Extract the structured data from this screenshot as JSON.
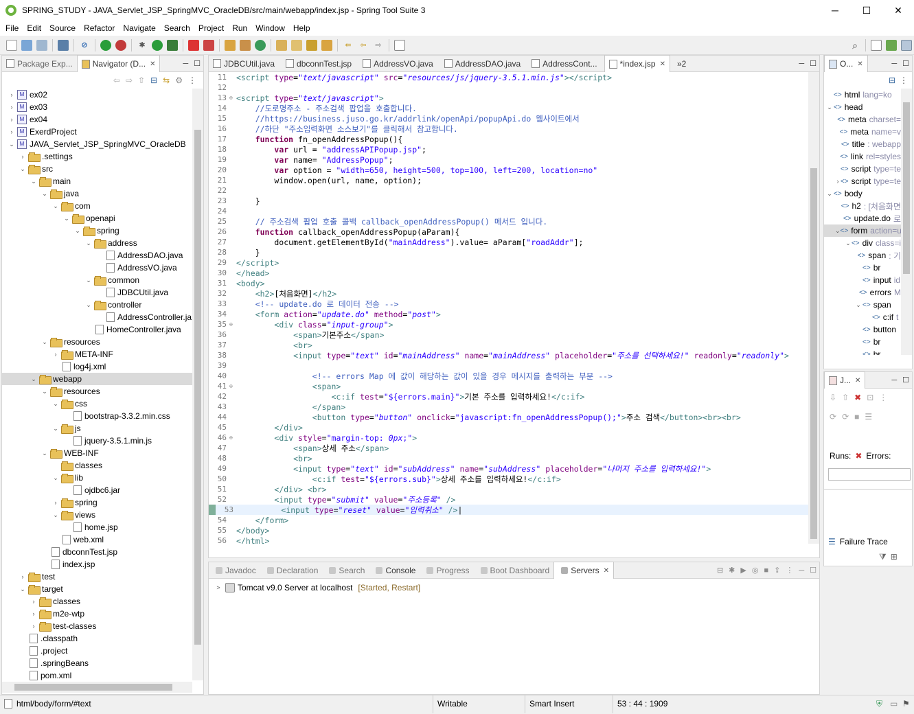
{
  "window": {
    "title": "SPRING_STUDY - JAVA_Servlet_JSP_SpringMVC_OracleDB/src/main/webapp/index.jsp - Spring Tool Suite 3",
    "minimize": "─",
    "maximize": "☐",
    "close": "✕"
  },
  "menu": [
    "File",
    "Edit",
    "Source",
    "Refactor",
    "Navigate",
    "Search",
    "Project",
    "Run",
    "Window",
    "Help"
  ],
  "left_panel": {
    "tabs": [
      {
        "label": "Package Exp..."
      },
      {
        "label": "Navigator (D...",
        "active": true
      }
    ]
  },
  "tree": [
    {
      "indent": 0,
      "twisty": ">",
      "type": "proj",
      "label": "ex02"
    },
    {
      "indent": 0,
      "twisty": ">",
      "type": "proj",
      "label": "ex03"
    },
    {
      "indent": 0,
      "twisty": ">",
      "type": "proj",
      "label": "ex04"
    },
    {
      "indent": 0,
      "twisty": ">",
      "type": "proj",
      "label": "ExerdProject"
    },
    {
      "indent": 0,
      "twisty": "v",
      "type": "proj",
      "label": "JAVA_Servlet_JSP_SpringMVC_OracleDB"
    },
    {
      "indent": 1,
      "twisty": ">",
      "type": "folder",
      "label": ".settings"
    },
    {
      "indent": 1,
      "twisty": "v",
      "type": "folder",
      "label": "src"
    },
    {
      "indent": 2,
      "twisty": "v",
      "type": "folder",
      "label": "main"
    },
    {
      "indent": 3,
      "twisty": "v",
      "type": "folder",
      "label": "java"
    },
    {
      "indent": 4,
      "twisty": "v",
      "type": "folder",
      "label": "com"
    },
    {
      "indent": 5,
      "twisty": "v",
      "type": "folder",
      "label": "openapi"
    },
    {
      "indent": 6,
      "twisty": "v",
      "type": "folder",
      "label": "spring"
    },
    {
      "indent": 7,
      "twisty": "v",
      "type": "folder",
      "label": "address"
    },
    {
      "indent": 8,
      "twisty": "",
      "type": "file",
      "label": "AddressDAO.java"
    },
    {
      "indent": 8,
      "twisty": "",
      "type": "file",
      "label": "AddressVO.java"
    },
    {
      "indent": 7,
      "twisty": "v",
      "type": "folder",
      "label": "common"
    },
    {
      "indent": 8,
      "twisty": "",
      "type": "file",
      "label": "JDBCUtil.java"
    },
    {
      "indent": 7,
      "twisty": "v",
      "type": "folder",
      "label": "controller"
    },
    {
      "indent": 8,
      "twisty": "",
      "type": "file",
      "label": "AddressController.ja"
    },
    {
      "indent": 7,
      "twisty": "",
      "type": "file",
      "label": "HomeController.java"
    },
    {
      "indent": 3,
      "twisty": "v",
      "type": "folder",
      "label": "resources"
    },
    {
      "indent": 4,
      "twisty": ">",
      "type": "folder",
      "label": "META-INF"
    },
    {
      "indent": 4,
      "twisty": "",
      "type": "file",
      "label": "log4j.xml"
    },
    {
      "indent": 2,
      "twisty": "v",
      "type": "folder",
      "label": "webapp",
      "selected": true
    },
    {
      "indent": 3,
      "twisty": "v",
      "type": "folder",
      "label": "resources"
    },
    {
      "indent": 4,
      "twisty": "v",
      "type": "folder",
      "label": "css"
    },
    {
      "indent": 5,
      "twisty": "",
      "type": "file",
      "label": "bootstrap-3.3.2.min.css"
    },
    {
      "indent": 4,
      "twisty": "v",
      "type": "folder",
      "label": "js"
    },
    {
      "indent": 5,
      "twisty": "",
      "type": "file",
      "label": "jquery-3.5.1.min.js"
    },
    {
      "indent": 3,
      "twisty": "v",
      "type": "folder",
      "label": "WEB-INF"
    },
    {
      "indent": 4,
      "twisty": "",
      "type": "folder",
      "label": "classes"
    },
    {
      "indent": 4,
      "twisty": "v",
      "type": "folder",
      "label": "lib"
    },
    {
      "indent": 5,
      "twisty": "",
      "type": "file",
      "label": "ojdbc6.jar"
    },
    {
      "indent": 4,
      "twisty": ">",
      "type": "folder",
      "label": "spring"
    },
    {
      "indent": 4,
      "twisty": "v",
      "type": "folder",
      "label": "views"
    },
    {
      "indent": 5,
      "twisty": "",
      "type": "file",
      "label": "home.jsp"
    },
    {
      "indent": 4,
      "twisty": "",
      "type": "file",
      "label": "web.xml"
    },
    {
      "indent": 3,
      "twisty": "",
      "type": "file",
      "label": "dbconnTest.jsp"
    },
    {
      "indent": 3,
      "twisty": "",
      "type": "file",
      "label": "index.jsp"
    },
    {
      "indent": 1,
      "twisty": ">",
      "type": "folder",
      "label": "test"
    },
    {
      "indent": 1,
      "twisty": "v",
      "type": "folder",
      "label": "target"
    },
    {
      "indent": 2,
      "twisty": ">",
      "type": "folder",
      "label": "classes"
    },
    {
      "indent": 2,
      "twisty": ">",
      "type": "folder",
      "label": "m2e-wtp"
    },
    {
      "indent": 2,
      "twisty": ">",
      "type": "folder",
      "label": "test-classes"
    },
    {
      "indent": 1,
      "twisty": "",
      "type": "file",
      "label": ".classpath"
    },
    {
      "indent": 1,
      "twisty": "",
      "type": "file",
      "label": ".project"
    },
    {
      "indent": 1,
      "twisty": "",
      "type": "file",
      "label": ".springBeans"
    },
    {
      "indent": 1,
      "twisty": "",
      "type": "file",
      "label": "pom.xml"
    }
  ],
  "editor": {
    "tabs": [
      {
        "label": "JDBCUtil.java"
      },
      {
        "label": "dbconnTest.jsp"
      },
      {
        "label": "AddressVO.java"
      },
      {
        "label": "AddressDAO.java"
      },
      {
        "label": "AddressCont..."
      },
      {
        "label": "*index.jsp",
        "active": true
      }
    ],
    "overflow": "»2"
  },
  "code": [
    {
      "n": "11",
      "f": "",
      "h": "<span class='tag'>&lt;script</span> <span class='attr'>type</span>=<span class='val'>\"text/javascript\"</span> <span class='attr'>src</span>=<span class='val'>\"resources/js/jquery-3.5.1.min.js\"</span><span class='tag'>&gt;&lt;/script&gt;</span>"
    },
    {
      "n": "12",
      "f": "",
      "h": ""
    },
    {
      "n": "13",
      "f": "⊖",
      "h": "<span class='tag'>&lt;script</span> <span class='attr'>type</span>=<span class='val'>\"text/javascript\"</span><span class='tag'>&gt;</span>"
    },
    {
      "n": "14",
      "f": "",
      "h": "    <span class='cmt'>//도로명주소 - 주소검색 팝업을 호출합니다.</span>"
    },
    {
      "n": "15",
      "f": "",
      "h": "    <span class='cmt'>//https://business.juso.go.kr/addrlink/openApi/popupApi.do 웹사이트에서</span>"
    },
    {
      "n": "16",
      "f": "",
      "h": "    <span class='cmt'>//하단 \"주소입력화면 소스보기\"를 클릭해서 참고합니다.</span>"
    },
    {
      "n": "17",
      "f": "",
      "h": "    <span class='kw'>function</span> fn_openAddressPopup(){"
    },
    {
      "n": "18",
      "f": "",
      "h": "        <span class='kw'>var</span> url = <span class='str'>\"addressAPIPopup.jsp\"</span>;"
    },
    {
      "n": "19",
      "f": "",
      "h": "        <span class='kw'>var</span> name= <span class='str'>\"AddressPopup\"</span>;"
    },
    {
      "n": "20",
      "f": "",
      "h": "        <span class='kw'>var</span> option = <span class='str'>\"width=650, height=500, top=100, left=200, location=no\"</span>"
    },
    {
      "n": "21",
      "f": "",
      "h": "        window.open(url, name, option);"
    },
    {
      "n": "22",
      "f": "",
      "h": ""
    },
    {
      "n": "23",
      "f": "",
      "h": "    }"
    },
    {
      "n": "24",
      "f": "",
      "h": ""
    },
    {
      "n": "25",
      "f": "",
      "h": "    <span class='cmt'>// 주소검색 팝업 호출 콜백 callback_openAddressPopup() 메서드 입니다.</span>"
    },
    {
      "n": "26",
      "f": "",
      "h": "    <span class='kw'>function</span> callback_openAddressPopup(aParam){"
    },
    {
      "n": "27",
      "f": "",
      "h": "        document.getElementById(<span class='str'>\"mainAddress\"</span>).value= aParam[<span class='str'>\"roadAddr\"</span>];"
    },
    {
      "n": "28",
      "f": "",
      "h": "    }"
    },
    {
      "n": "29",
      "f": "",
      "h": "<span class='tag'>&lt;/script&gt;</span>"
    },
    {
      "n": "30",
      "f": "",
      "h": "<span class='tag'>&lt;/head&gt;</span>"
    },
    {
      "n": "31",
      "f": "",
      "h": "<span class='tag'>&lt;body&gt;</span>"
    },
    {
      "n": "32",
      "f": "",
      "h": "    <span class='tag'>&lt;h2&gt;</span>[처음화면]<span class='tag'>&lt;/h2&gt;</span>"
    },
    {
      "n": "33",
      "f": "",
      "h": "    <span class='cmt'>&lt;!-- update.do 로 데이터 전송 --&gt;</span>"
    },
    {
      "n": "34",
      "f": "",
      "h": "    <span class='tag'>&lt;form</span> <span class='attr'>action</span>=<span class='val'>\"update.do\"</span> <span class='attr'>method</span>=<span class='val'>\"post\"</span><span class='tag'>&gt;</span>"
    },
    {
      "n": "35",
      "f": "⊖",
      "h": "        <span class='tag'>&lt;div</span> <span class='attr'>class</span>=<span class='val'>\"input-group\"</span><span class='tag'>&gt;</span>"
    },
    {
      "n": "36",
      "f": "",
      "h": "            <span class='tag'>&lt;span&gt;</span>기본주소<span class='tag'>&lt;/span&gt;</span>"
    },
    {
      "n": "37",
      "f": "",
      "h": "            <span class='tag'>&lt;br&gt;</span>"
    },
    {
      "n": "38",
      "f": "",
      "h": "            <span class='tag'>&lt;input</span> <span class='attr'>type</span>=<span class='val'>\"text\"</span> <span class='attr'>id</span>=<span class='val'>\"mainAddress\"</span> <span class='attr'>name</span>=<span class='val'>\"mainAddress\"</span> <span class='attr'>placeholder</span>=<span class='val'>\"주소를 선택하세요!\"</span> <span class='attr'>readonly</span>=<span class='val'>\"readonly\"</span><span class='tag'>&gt;</span>"
    },
    {
      "n": "39",
      "f": "",
      "h": ""
    },
    {
      "n": "40",
      "f": "",
      "h": "                <span class='cmt'>&lt;!-- errors Map 에 값이 해당하는 값이 있을 경우 메시지를 출력하는 부분 --&gt;</span>"
    },
    {
      "n": "41",
      "f": "⊖",
      "h": "                <span class='tag'>&lt;span&gt;</span>"
    },
    {
      "n": "42",
      "f": "",
      "h": "                    <span class='tag'>&lt;c:if</span> <span class='attr'>test</span>=<span class='str'>\"${errors.main}\"</span><span class='tag'>&gt;</span>기본 주소를 입력하세요!<span class='tag'>&lt;/c:if&gt;</span>"
    },
    {
      "n": "43",
      "f": "",
      "h": "                <span class='tag'>&lt;/span&gt;</span>"
    },
    {
      "n": "44",
      "f": "",
      "h": "                <span class='tag'>&lt;button</span> <span class='attr'>type</span>=<span class='val'>\"button\"</span> <span class='attr'>onclick</span>=<span class='str'>\"javascript:fn_openAddressPopup();\"</span><span class='tag'>&gt;</span>주소 검색<span class='tag'>&lt;/button&gt;&lt;br&gt;&lt;br&gt;</span>"
    },
    {
      "n": "45",
      "f": "",
      "h": "        <span class='tag'>&lt;/div&gt;</span>"
    },
    {
      "n": "46",
      "f": "⊖",
      "h": "        <span class='tag'>&lt;div</span> <span class='attr'>style</span>=<span class='str'>\"margin-top: <i>0px</i>;\"</span><span class='tag'>&gt;</span>"
    },
    {
      "n": "47",
      "f": "",
      "h": "            <span class='tag'>&lt;span&gt;</span>상세 주소<span class='tag'>&lt;/span&gt;</span>"
    },
    {
      "n": "48",
      "f": "",
      "h": "            <span class='tag'>&lt;br&gt;</span>"
    },
    {
      "n": "49",
      "f": "",
      "h": "            <span class='tag'>&lt;input</span> <span class='attr'>type</span>=<span class='val'>\"text\"</span> <span class='attr'>id</span>=<span class='val'>\"subAddress\"</span> <span class='attr'>name</span>=<span class='val'>\"subAddress\"</span> <span class='attr'>placeholder</span>=<span class='val'>\"나머지 주소를 입력하세요!\"</span><span class='tag'>&gt;</span>"
    },
    {
      "n": "50",
      "f": "",
      "h": "                <span class='tag'>&lt;c:if</span> <span class='attr'>test</span>=<span class='str'>\"${errors.sub}\"</span><span class='tag'>&gt;</span>상세 주소를 입력하세요!<span class='tag'>&lt;/c:if&gt;</span>"
    },
    {
      "n": "51",
      "f": "",
      "h": "        <span class='tag'>&lt;/div&gt;</span> <span class='tag'>&lt;br&gt;</span>"
    },
    {
      "n": "52",
      "f": "",
      "h": "        <span class='tag'>&lt;input</span> <span class='attr'>type</span>=<span class='val'>\"submit\"</span> <span class='attr'>value</span>=<span class='val'>\"주소등록\"</span> <span class='tag'>/&gt;</span>"
    },
    {
      "n": "53",
      "f": "",
      "h": "        <span class='tag'>&lt;input</span> <span class='attr'>type</span>=<span class='val'>\"reset\"</span> <span class='attr'>value</span>=<span class='val'>\"입력취소\"</span> <span class='tag'>/&gt;</span>|",
      "current": true
    },
    {
      "n": "54",
      "f": "",
      "h": "    <span class='tag'>&lt;/form&gt;</span>"
    },
    {
      "n": "55",
      "f": "",
      "h": "<span class='tag'>&lt;/body&gt;</span>"
    },
    {
      "n": "56",
      "f": "",
      "h": "<span class='tag'>&lt;/html&gt;</span>"
    }
  ],
  "outline": {
    "tab": "O...",
    "items": [
      {
        "indent": 0,
        "label": "html",
        "extra": "lang=ko"
      },
      {
        "indent": 0,
        "label": "head",
        "tw": "v"
      },
      {
        "indent": 1,
        "label": "meta",
        "extra": "charset="
      },
      {
        "indent": 1,
        "label": "meta",
        "extra": "name=v"
      },
      {
        "indent": 1,
        "label": "title",
        "extra": ": webapp"
      },
      {
        "indent": 1,
        "label": "link",
        "extra": "rel=styles"
      },
      {
        "indent": 1,
        "label": "script",
        "extra": "type=te"
      },
      {
        "indent": 1,
        "label": "script",
        "extra": "type=te",
        "tw": ">"
      },
      {
        "indent": 0,
        "label": "body",
        "tw": "v"
      },
      {
        "indent": 1,
        "label": "h2",
        "extra": ": [처음화면"
      },
      {
        "indent": 1,
        "label": "update.do",
        "extra": "로"
      },
      {
        "indent": 1,
        "label": "form",
        "extra": "action=u",
        "tw": "v",
        "sel": true
      },
      {
        "indent": 2,
        "label": "div",
        "extra": "class=i",
        "tw": "v"
      },
      {
        "indent": 3,
        "label": "span",
        "extra": ": 기"
      },
      {
        "indent": 3,
        "label": "br",
        "extra": ""
      },
      {
        "indent": 3,
        "label": "input",
        "extra": "id"
      },
      {
        "indent": 3,
        "label": "errors",
        "extra": "M"
      },
      {
        "indent": 3,
        "label": "span",
        "extra": "",
        "tw": "v"
      },
      {
        "indent": 4,
        "label": "c:if",
        "extra": "t"
      },
      {
        "indent": 3,
        "label": "button",
        "extra": ""
      },
      {
        "indent": 3,
        "label": "br",
        "extra": ""
      },
      {
        "indent": 3,
        "label": "br",
        "extra": ""
      }
    ]
  },
  "junit": {
    "tab": "J...",
    "runs": "Runs:",
    "errors": "Errors:",
    "failure_trace": "Failure Trace"
  },
  "bottom": {
    "tabs": [
      {
        "label": "Javadoc"
      },
      {
        "label": "Declaration"
      },
      {
        "label": "Search"
      },
      {
        "label": "Console"
      },
      {
        "label": "Progress"
      },
      {
        "label": "Boot Dashboard"
      },
      {
        "label": "Servers",
        "active": true
      }
    ],
    "server": {
      "name": "Tomcat v9.0 Server at localhost",
      "state": "[Started, Restart]"
    }
  },
  "status": {
    "path": "html/body/form/#text",
    "writable": "Writable",
    "insert": "Smart Insert",
    "position": "53 : 44 : 1909"
  }
}
